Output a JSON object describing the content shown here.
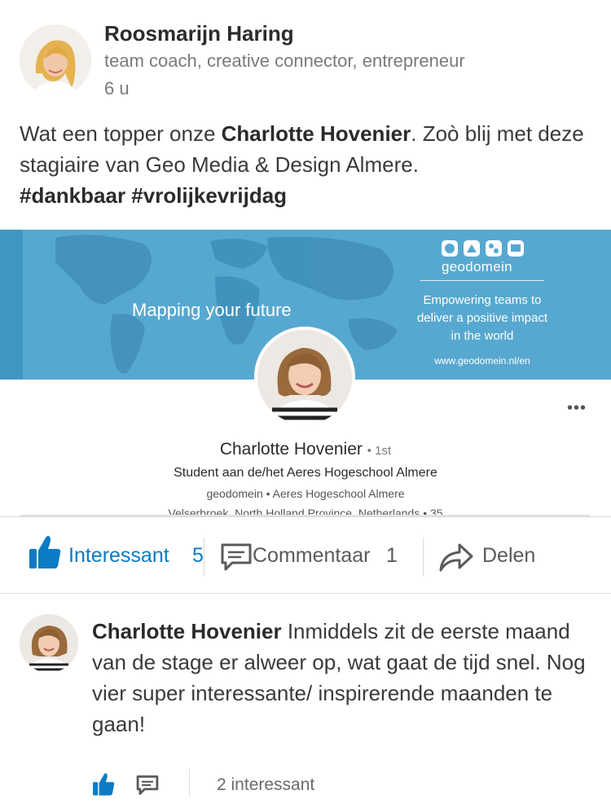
{
  "post": {
    "author_name": "Roosmarijn Haring",
    "author_headline": "team coach, creative connector, entrepreneur",
    "time": "6 u",
    "text_part1": "Wat een topper onze ",
    "mention": "Charlotte Hovenier",
    "text_part2": ". Zoò blij met deze stagiaire van Geo Media & Design Almere.",
    "hashtags": "#dankbaar #vrolijkevrijdag"
  },
  "shared_profile": {
    "banner_tagline": "Mapping your future",
    "brand_name": "geodomein",
    "brand_slogan_line1": "Empowering teams to",
    "brand_slogan_line2": "deliver a positive impact",
    "brand_slogan_line3": "in the world",
    "brand_url": "www.geodomein.nl/en",
    "more_label": "•••",
    "name": "Charlotte Hovenier",
    "degree": "• 1st",
    "title": "Student aan de/het Aeres Hogeschool Almere",
    "company": "geodomein • Aeres Hogeschool Almere",
    "location": "Velserbroek, North Holland Province, Netherlands • 35"
  },
  "actions": {
    "like_label": "Interessant",
    "like_count": "5",
    "comment_label": "Commentaar",
    "comment_count": "1",
    "share_label": "Delen",
    "accent_color": "#0a7bc4"
  },
  "comment": {
    "author": "Charlotte Hovenier",
    "text": " Inmiddels zit de eerste maand van de stage er alweer op, wat gaat de tijd snel. Nog vier super interessante/ inspirerende maanden te gaan!",
    "likes": "2 interessant"
  },
  "icons": {
    "like": "thumbs-up-icon",
    "comment": "speech-bubble-icon",
    "share": "share-arrow-icon",
    "more": "ellipsis-icon"
  }
}
